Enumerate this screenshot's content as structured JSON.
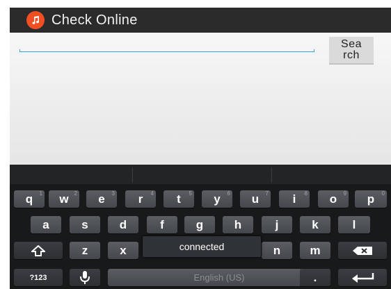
{
  "app": {
    "title": "Check Online",
    "icon": "music-note-icon",
    "accent": "#f04e23"
  },
  "search": {
    "value": "",
    "placeholder": "",
    "button_label": "Sea rch"
  },
  "keyboard": {
    "row1": [
      {
        "key": "q",
        "hint": "1"
      },
      {
        "key": "w",
        "hint": "2"
      },
      {
        "key": "e",
        "hint": "3"
      },
      {
        "key": "r",
        "hint": "4"
      },
      {
        "key": "t",
        "hint": "5"
      },
      {
        "key": "y",
        "hint": "6"
      },
      {
        "key": "u",
        "hint": "7"
      },
      {
        "key": "i",
        "hint": "8"
      },
      {
        "key": "o",
        "hint": "9"
      },
      {
        "key": "p",
        "hint": "0"
      }
    ],
    "row2": [
      "a",
      "s",
      "d",
      "f",
      "g",
      "h",
      "j",
      "k",
      "l"
    ],
    "row3": [
      "z",
      "x",
      "n",
      "m"
    ],
    "symbols_label": "?123",
    "space_label": "English (US)",
    "period_label": "."
  },
  "toast": {
    "text": "connected"
  }
}
